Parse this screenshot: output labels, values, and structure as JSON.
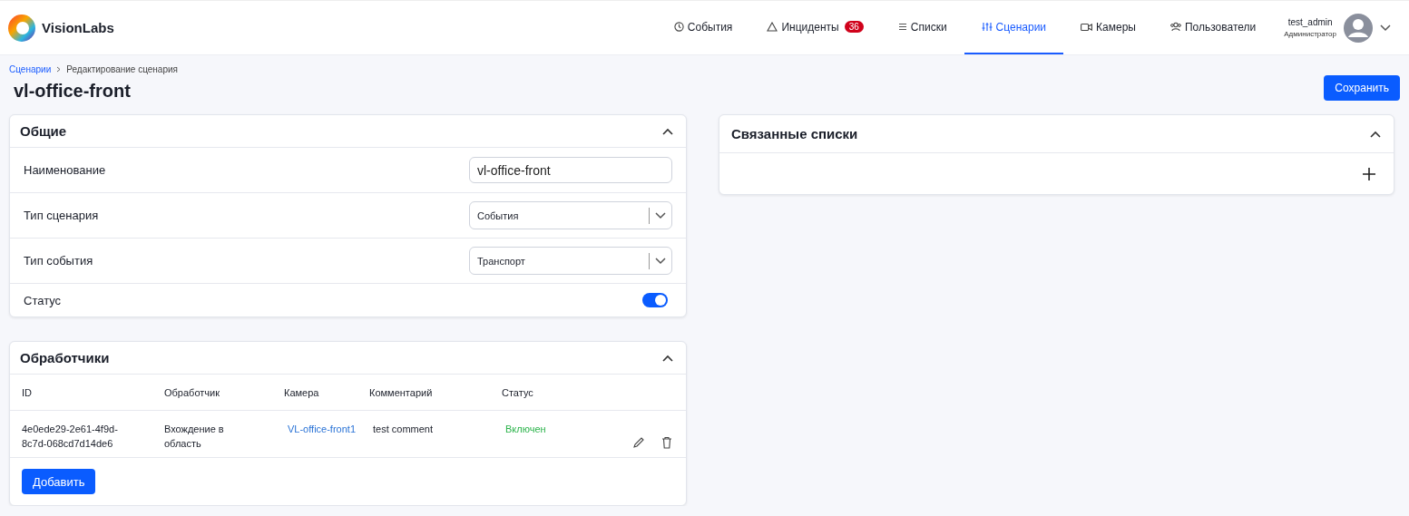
{
  "header": {
    "logo": "VisionLabs",
    "nav": [
      {
        "label": "События",
        "selected": false
      },
      {
        "label": "Инциденты",
        "badge": "36",
        "selected": false
      },
      {
        "label": "Списки",
        "selected": false
      },
      {
        "label": "Сценарии",
        "selected": true
      },
      {
        "label": "Камеры",
        "selected": false
      },
      {
        "label": "Пользователи",
        "selected": false
      }
    ],
    "user": {
      "name": "test_admin",
      "role": "Администратор"
    }
  },
  "breadcrumb": {
    "link": "Сценарии",
    "current": "Редактирование сценария"
  },
  "title": "vl-office-front",
  "save_button": "Сохранить",
  "general": {
    "title": "Общие",
    "expanded": true,
    "fields": [
      {
        "kind": "text",
        "label": "Наименование",
        "value": "vl-office-front"
      },
      {
        "kind": "select",
        "label": "Тип сценария",
        "value": "События"
      },
      {
        "kind": "select",
        "label": "Тип события",
        "value": "Транспорт"
      },
      {
        "kind": "toggle",
        "label": "Статус",
        "on": true
      }
    ]
  },
  "handlers": {
    "title": "Обработчики",
    "expanded": true,
    "table": {
      "columns": [
        "ID",
        "Обработчик",
        "Камера",
        "Комментарий",
        "Статус"
      ],
      "rows": [
        {
          "id": "4e0ede29-2e61-4f9d-8c7d-068cd7d14de6",
          "handler": "Вхождение в область",
          "camera": "VL-office-front1",
          "comment": "test comment",
          "status": "Включен",
          "enabled": true
        }
      ]
    },
    "add_button": "Добавить"
  },
  "linked_lists": {
    "title": "Связанные списки",
    "expanded": true
  }
}
